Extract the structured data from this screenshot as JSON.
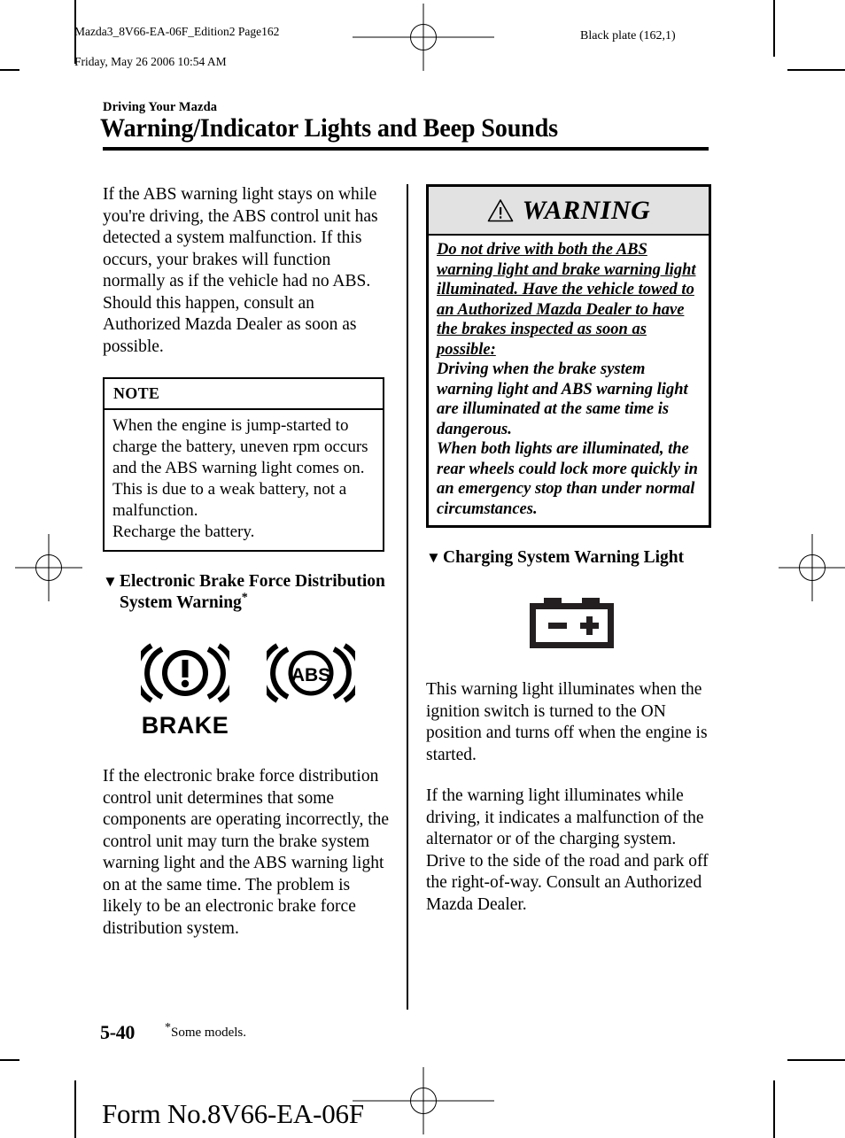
{
  "print_header": {
    "file_line": "Mazda3_8V66-EA-06F_Edition2 Page162",
    "date_line": "Friday, May 26 2006 10:54 AM",
    "black_plate": "Black plate (162,1)"
  },
  "header": {
    "eyebrow": "Driving Your Mazda",
    "title": "Warning/Indicator Lights and Beep Sounds"
  },
  "left_column": {
    "intro_paragraph": "If the ABS warning light stays on while you're driving, the ABS control unit has detected a system malfunction. If this occurs, your brakes will function normally as if the vehicle had no ABS.",
    "intro_paragraph2": "Should this happen, consult an Authorized Mazda Dealer as soon as possible.",
    "note_box": {
      "heading": "NOTE",
      "line1": "When the engine is jump-started to charge the battery, uneven rpm occurs and the ABS warning light comes on. This is due to a weak battery, not a malfunction.",
      "line2": "Recharge the battery."
    },
    "section_heading": "Electronic Brake Force Distribution System Warning",
    "section_heading_marker": "*",
    "icons": {
      "brake_label": "BRAKE",
      "abs_label": "ABS",
      "brake_icon_name": "brake-warning-indicator",
      "abs_icon_name": "abs-warning-indicator"
    },
    "body_paragraph": "If the electronic brake force distribution control unit determines that some components are operating incorrectly, the control unit may turn the brake system warning light and the ABS warning light on at the same time. The problem is likely to be an electronic brake force distribution system."
  },
  "right_column": {
    "warning_box": {
      "title": "WARNING",
      "icon_name": "warning-triangle-icon",
      "underlined_text": "Do not drive with both the ABS warning light and brake warning light illuminated. Have the vehicle towed to an Authorized Mazda Dealer to have the brakes inspected as soon as possible:",
      "paragraph1": "Driving when the brake system warning light and ABS warning light are illuminated at the same time is dangerous.",
      "paragraph2": "When both lights are illuminated, the rear wheels could lock more quickly in an emergency stop than under normal circumstances."
    },
    "section_heading": "Charging System Warning Light",
    "icon_name": "battery-charging-indicator",
    "paragraph1": "This warning light illuminates when the ignition switch is turned to the ON position and turns off when the engine is started.",
    "paragraph2": "If the warning light illuminates while driving, it indicates a malfunction of the alternator or of the charging system. Drive to the side of the road and park off the right-of-way. Consult an Authorized Mazda Dealer."
  },
  "footer": {
    "page_number": "5-40",
    "footnote_marker": "*",
    "footnote_text": "Some models.",
    "form_number": "Form No.8V66-EA-06F"
  },
  "colors": {
    "warning_header_background": "#e2e2e2",
    "text": "#000000",
    "page_background": "#ffffff"
  }
}
